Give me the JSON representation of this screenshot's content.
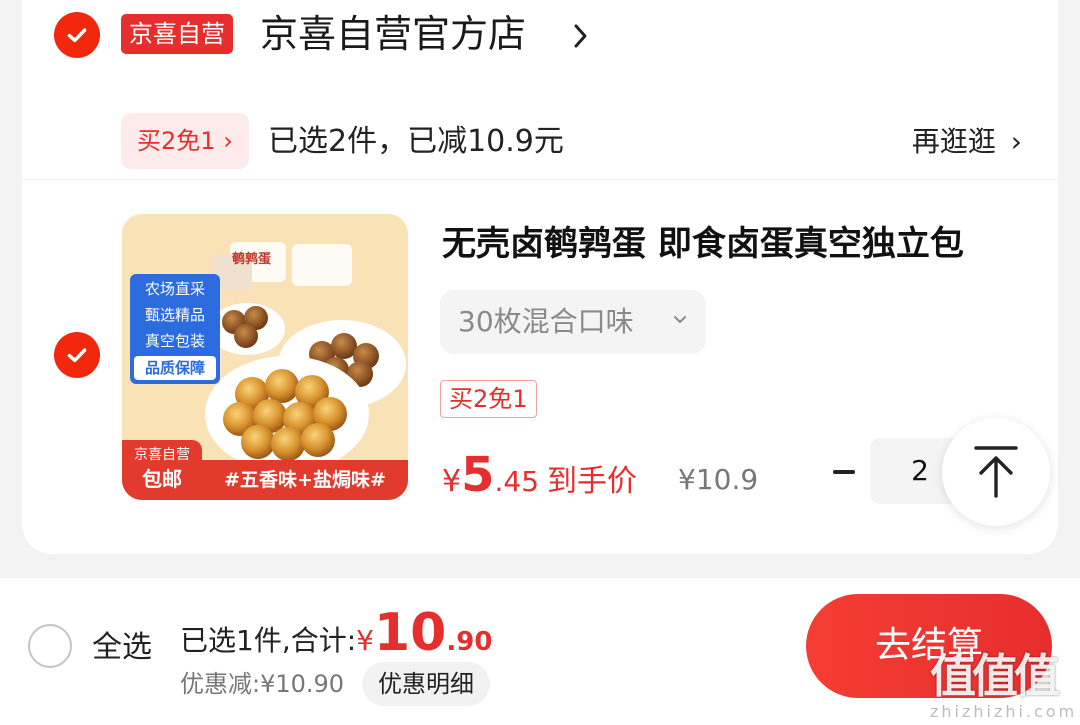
{
  "colors": {
    "accent": "#e62e2e",
    "check": "#f2270c",
    "badge_bg": "#fdeaea"
  },
  "store": {
    "self_operated_tag": "京喜自营",
    "name": "京喜自营官方店",
    "chevron_icon": "chevron-right-icon"
  },
  "promo": {
    "chip_label": "买2免1",
    "chip_chevron": "›",
    "status_text": "已选2件，已减10.9元",
    "shop_more_label": "再逛逛",
    "shop_more_chevron": "›"
  },
  "product": {
    "title": "无壳卤鹌鹑蛋 即食卤蛋真空独立包",
    "variant": "30枚混合口味",
    "badge": "买2免1",
    "price_currency": "¥",
    "price_integer": "5",
    "price_decimal": ".45",
    "price_label": "到手价",
    "original_price": "¥10.9",
    "quantity": "2",
    "image": {
      "brand": "鹌鹑蛋",
      "features": [
        "农场直采",
        "甄选精品",
        "真空包装",
        "品质保障"
      ],
      "shop_tag": "京喜自营",
      "shipping": "包邮",
      "flavors": "#五香味+盐焗味#"
    }
  },
  "footer": {
    "select_all_label": "全选",
    "summary_label": "已选1件,合计:",
    "total_currency": "¥",
    "total_integer": "10",
    "total_decimal": ".90",
    "discount_text": "优惠减:¥10.90",
    "discount_detail_button": "优惠明细",
    "checkout_button": "去结算"
  },
  "watermark": {
    "text": "值值值",
    "url": "zhizhizhi.com"
  }
}
